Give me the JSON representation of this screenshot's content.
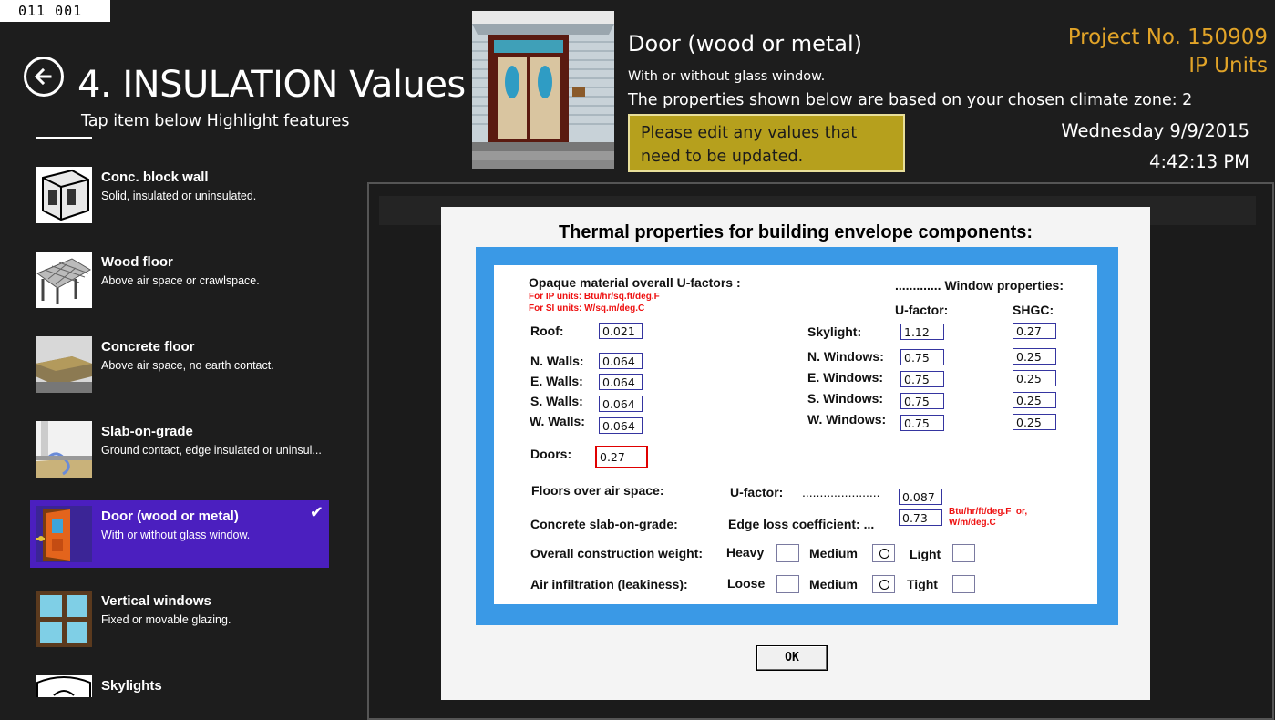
{
  "corner_label": "011  001",
  "header": {
    "title": "4. INSULATION Values",
    "subtitle": "Tap item below Highlight features",
    "door_title": "Door (wood or metal)",
    "door_subtitle": "With or without glass window.",
    "climate_text": "The properties shown below are based on your chosen climate zone: 2",
    "edit_notice": "Please edit any values that need to be updated.",
    "project_no": "Project No. 150909",
    "units": "IP Units",
    "date": "Wednesday 9/9/2015",
    "time": "4:42:13 PM",
    "accent_color": "#e2a428"
  },
  "sidebar": {
    "items": [
      {
        "title": "Conc. block wall",
        "desc": "Solid, insulated or uninsulated.",
        "icon": "concrete-block-icon"
      },
      {
        "title": "Wood floor",
        "desc": "Above air space or crawlspace.",
        "icon": "wood-floor-icon"
      },
      {
        "title": "Concrete floor",
        "desc": "Above air space, no earth contact.",
        "icon": "concrete-floor-icon"
      },
      {
        "title": "Slab-on-grade",
        "desc": "Ground contact, edge insulated or uninsul...",
        "icon": "slab-icon"
      },
      {
        "title": "Door (wood or metal)",
        "desc": "With or without glass window.",
        "icon": "door-icon",
        "selected": true
      },
      {
        "title": "Vertical windows",
        "desc": "Fixed or movable glazing.",
        "icon": "window-icon"
      },
      {
        "title": "Skylights",
        "desc": "",
        "icon": "skylight-icon"
      }
    ],
    "selected_color": "#4b1fbf"
  },
  "dialog": {
    "title": "Thermal properties for building envelope components:",
    "opaque_heading": "Opaque material overall U-factors :",
    "ip_note": "For IP units: Btu/hr/sq.ft/deg.F",
    "si_note": "For SI units: W/sq.m/deg.C",
    "window_heading": "............. Window properties:",
    "u_factor_header": "U-factor:",
    "shgc_header": "SHGC:",
    "opaque": [
      {
        "label": "Roof:",
        "value": "0.021"
      },
      {
        "label": "N. Walls:",
        "value": "0.064"
      },
      {
        "label": "E. Walls:",
        "value": "0.064"
      },
      {
        "label": "S. Walls:",
        "value": "0.064"
      },
      {
        "label": "W. Walls:",
        "value": "0.064"
      },
      {
        "label": "Doors:",
        "value": "0.27"
      }
    ],
    "windows": [
      {
        "label": "Skylight:",
        "u": "1.12",
        "shgc": "0.27"
      },
      {
        "label": "N. Windows:",
        "u": "0.75",
        "shgc": "0.25"
      },
      {
        "label": "E. Windows:",
        "u": "0.75",
        "shgc": "0.25"
      },
      {
        "label": "S. Windows:",
        "u": "0.75",
        "shgc": "0.25"
      },
      {
        "label": "W. Windows:",
        "u": "0.75",
        "shgc": "0.25"
      }
    ],
    "floors_label": "Floors over air space:",
    "floors_u_label": "U-factor:",
    "floors_dots": "......................",
    "floors_value": "0.087",
    "slab_label": "Concrete slab-on-grade:",
    "slab_edge_label": "Edge loss coefficient: ...",
    "slab_value": "0.73",
    "slab_units": "Btu/hr/ft/deg.F  or,\nW/m/deg.C",
    "weight_label": "Overall construction weight:",
    "weight_options": [
      "Heavy",
      "Medium",
      "Light"
    ],
    "weight_selected": "Medium",
    "infiltration_label": "Air infiltration (leakiness):",
    "infiltration_options": [
      "Loose",
      "Medium",
      "Tight"
    ],
    "infiltration_selected": "Medium",
    "ok_label": "OK"
  }
}
